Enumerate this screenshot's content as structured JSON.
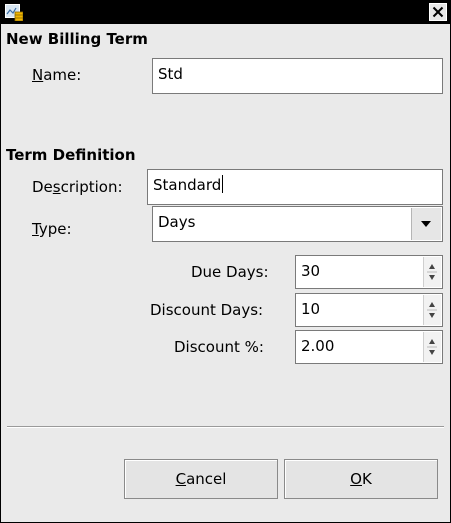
{
  "dialog": {
    "section_billing": "New Billing Term",
    "name_label_mnemonic": "N",
    "name_label_rest": "ame:",
    "name_value": "Std",
    "section_definition": "Term Definition",
    "description_label_pre": "De",
    "description_label_mnemonic": "s",
    "description_label_post": "cription:",
    "description_value": "Standard",
    "type_label_mnemonic": "T",
    "type_label_rest": "ype:",
    "type_value": "Days",
    "due_days_label": "Due Days:",
    "due_days_value": "30",
    "discount_days_label": "Discount Days:",
    "discount_days_value": "10",
    "discount_pct_label": "Discount %:",
    "discount_pct_value": "2.00",
    "cancel_mnemonic": "C",
    "cancel_rest": "ancel",
    "ok_mnemonic": "O",
    "ok_rest": "K"
  },
  "icons": {
    "app": "app-icon",
    "close": "close-icon",
    "dropdown": "chevron-down-icon",
    "spin": "spin-arrows-icon"
  }
}
